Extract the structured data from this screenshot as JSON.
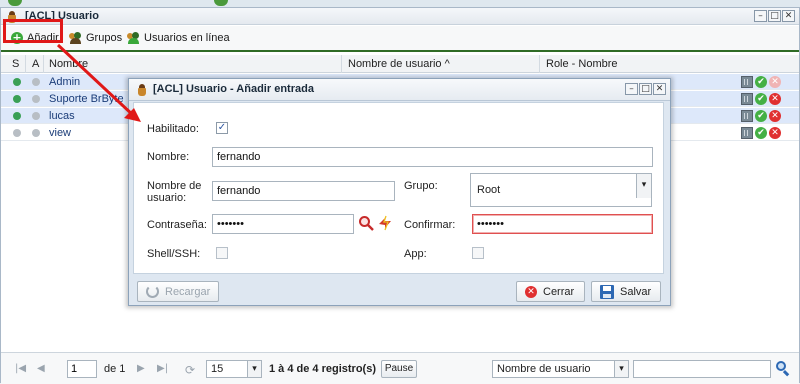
{
  "main_window": {
    "title": "[ACL] Usuario",
    "toolbar": {
      "add_label": "Añadir",
      "groups_label": "Grupos",
      "online_label": "Usuarios en línea"
    },
    "columns": {
      "s": "S",
      "a": "A",
      "name": "Nombre",
      "username": "Nombre de usuario ^",
      "role": "Role - Nombre"
    },
    "rows": [
      {
        "name": "Admin",
        "s_color": "#3aa055",
        "a_color": "#b8bec4",
        "selected": true
      },
      {
        "name": "Suporte BrByte",
        "s_color": "#3aa055",
        "a_color": "#b8bec4",
        "selected": true
      },
      {
        "name": "lucas",
        "s_color": "#3aa055",
        "a_color": "#b8bec4",
        "selected": true
      },
      {
        "name": "view",
        "s_color": "#b8bec4",
        "a_color": "#b8bec4",
        "selected": false
      }
    ],
    "pager": {
      "page": "1",
      "of": "de 1",
      "page_size": "15",
      "summary": "1 à 4 de 4 registro(s)",
      "pause": "Pause",
      "search_field": "Nombre de usuario",
      "search_value": ""
    }
  },
  "dialog": {
    "title": "[ACL] Usuario - Añadir entrada",
    "enabled_label": "Habilitado:",
    "enabled_checked": true,
    "name_label": "Nombre:",
    "name_value": "fernando",
    "username_label_1": "Nombre de",
    "username_label_2": "usuario:",
    "username_value": "fernando",
    "group_label": "Grupo:",
    "group_value": "Root",
    "password_label": "Contraseña:",
    "password_value": "•••••••",
    "confirm_label": "Confirmar:",
    "confirm_value": "•••••••",
    "shell_label": "Shell/SSH:",
    "shell_checked": false,
    "app_label": "App:",
    "app_checked": false,
    "reload_label": "Recargar",
    "close_label": "Cerrar",
    "save_label": "Salvar"
  },
  "colors": {
    "accent_green": "#2f6b25",
    "highlight_red": "#e01818",
    "selected_row": "#dde8fa"
  }
}
